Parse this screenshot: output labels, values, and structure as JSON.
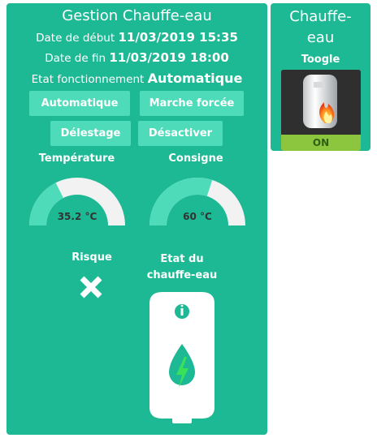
{
  "main": {
    "title": "Gestion Chauffe-eau",
    "start_label": "Date de début",
    "start_value": "11/03/2019 15:35",
    "end_label": "Date de fin",
    "end_value": "11/03/2019 18:00",
    "state_label": "Etat fonctionnement",
    "state_value": "Automatique",
    "buttons": {
      "auto": "Automatique",
      "forced": "Marche forcée",
      "shedding": "Délestage",
      "disable": "Désactiver"
    },
    "temperature": {
      "label": "Température",
      "value": 35.2,
      "unit": "°C",
      "display": "35.2 °C"
    },
    "setpoint": {
      "label": "Consigne",
      "value": 60,
      "unit": "°C",
      "display": "60 °C"
    },
    "risk_label": "Risque",
    "risk_icon": "close-icon",
    "heater_label_line1": "Etat du",
    "heater_label_line2": "chauffe-eau",
    "heater_icon": "water-heater-icon"
  },
  "side": {
    "title_line1": "Chauffe-",
    "title_line2": "eau",
    "subtitle": "Toogle",
    "toggle_state": "ON"
  },
  "colors": {
    "panel": "#1db894",
    "button": "#4ddbb9",
    "gauge_fill": "#4ddbb9",
    "gauge_track": "#f2f2f2",
    "on_green": "#8cc63f"
  }
}
